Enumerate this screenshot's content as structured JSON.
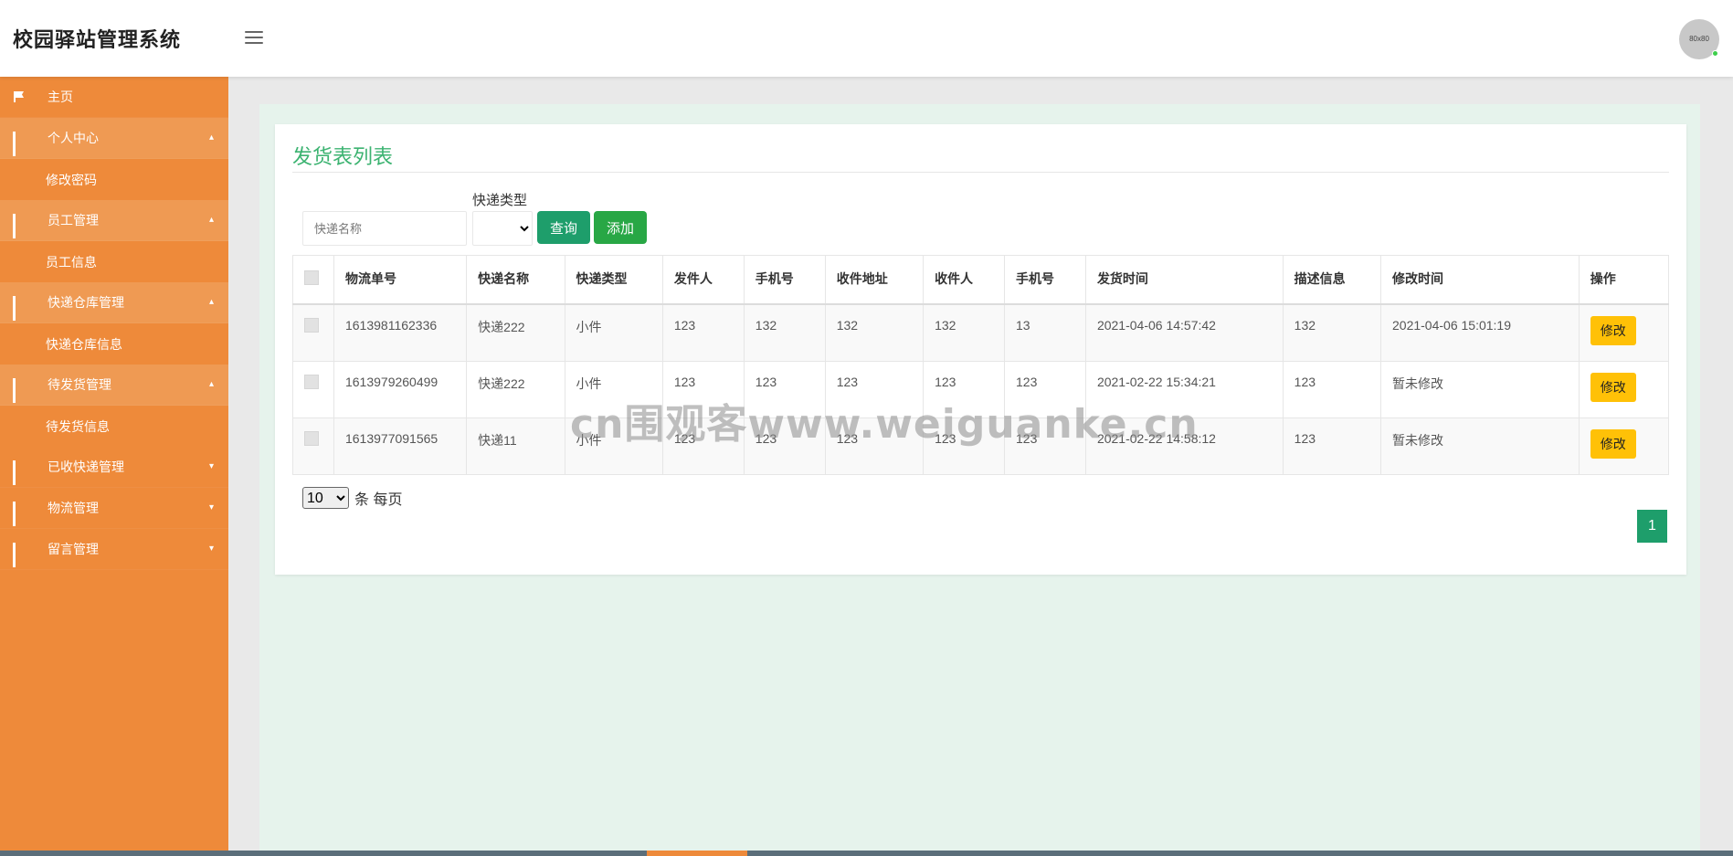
{
  "header": {
    "app_title": "校园驿站管理系统",
    "avatar_text": "80x80"
  },
  "sidebar": {
    "items": [
      {
        "label": "主页",
        "icon": "flag-icon"
      },
      {
        "label": "个人中心",
        "icon": "grid-icon",
        "expanded": true,
        "children": [
          "修改密码"
        ]
      },
      {
        "label": "员工管理",
        "icon": "grid-icon",
        "expanded": true,
        "children": [
          "员工信息"
        ]
      },
      {
        "label": "快递仓库管理",
        "icon": "grid-icon",
        "expanded": true,
        "children": [
          "快递仓库信息"
        ]
      },
      {
        "label": "待发货管理",
        "icon": "grid-icon",
        "expanded": true,
        "children": [
          "待发货信息"
        ]
      },
      {
        "label": "已收快递管理",
        "icon": "grid-icon",
        "expanded": false
      },
      {
        "label": "物流管理",
        "icon": "grid-icon",
        "expanded": false
      },
      {
        "label": "留言管理",
        "icon": "grid-icon",
        "expanded": false
      }
    ]
  },
  "main": {
    "title": "发货表列表",
    "search": {
      "placeholder": "快递名称",
      "filter_label": "快递类型",
      "filter_value": "",
      "query_label": "查询",
      "add_label": "添加"
    },
    "table": {
      "columns": [
        "物流单号",
        "快递名称",
        "快递类型",
        "发件人",
        "手机号",
        "收件地址",
        "收件人",
        "手机号",
        "发货时间",
        "描述信息",
        "修改时间",
        "操作"
      ],
      "rows": [
        [
          "1613981162336",
          "快递222",
          "小件",
          "123",
          "132",
          "132",
          "132",
          "13",
          "2021-04-06 14:57:42",
          "132",
          "2021-04-06 15:01:19"
        ],
        [
          "1613979260499",
          "快递222",
          "小件",
          "123",
          "123",
          "123",
          "123",
          "123",
          "2021-02-22 15:34:21",
          "123",
          "暂未修改"
        ],
        [
          "1613977091565",
          "快递11",
          "小件",
          "123",
          "123",
          "123",
          "123",
          "123",
          "2021-02-22 14:58:12",
          "123",
          "暂未修改"
        ]
      ],
      "edit_label": "修改"
    },
    "pagination": {
      "page_size": "10",
      "page_size_suffix": "条 每页",
      "current_page": "1"
    }
  },
  "watermark": "cn围观客www.weiguanke.cn",
  "colors": {
    "sidebar": "#ee8a3a",
    "title": "#3cb371",
    "primary": "#1e9e6b",
    "add": "#28a745",
    "edit": "#ffc107",
    "content_bg": "#e6f3ec"
  }
}
